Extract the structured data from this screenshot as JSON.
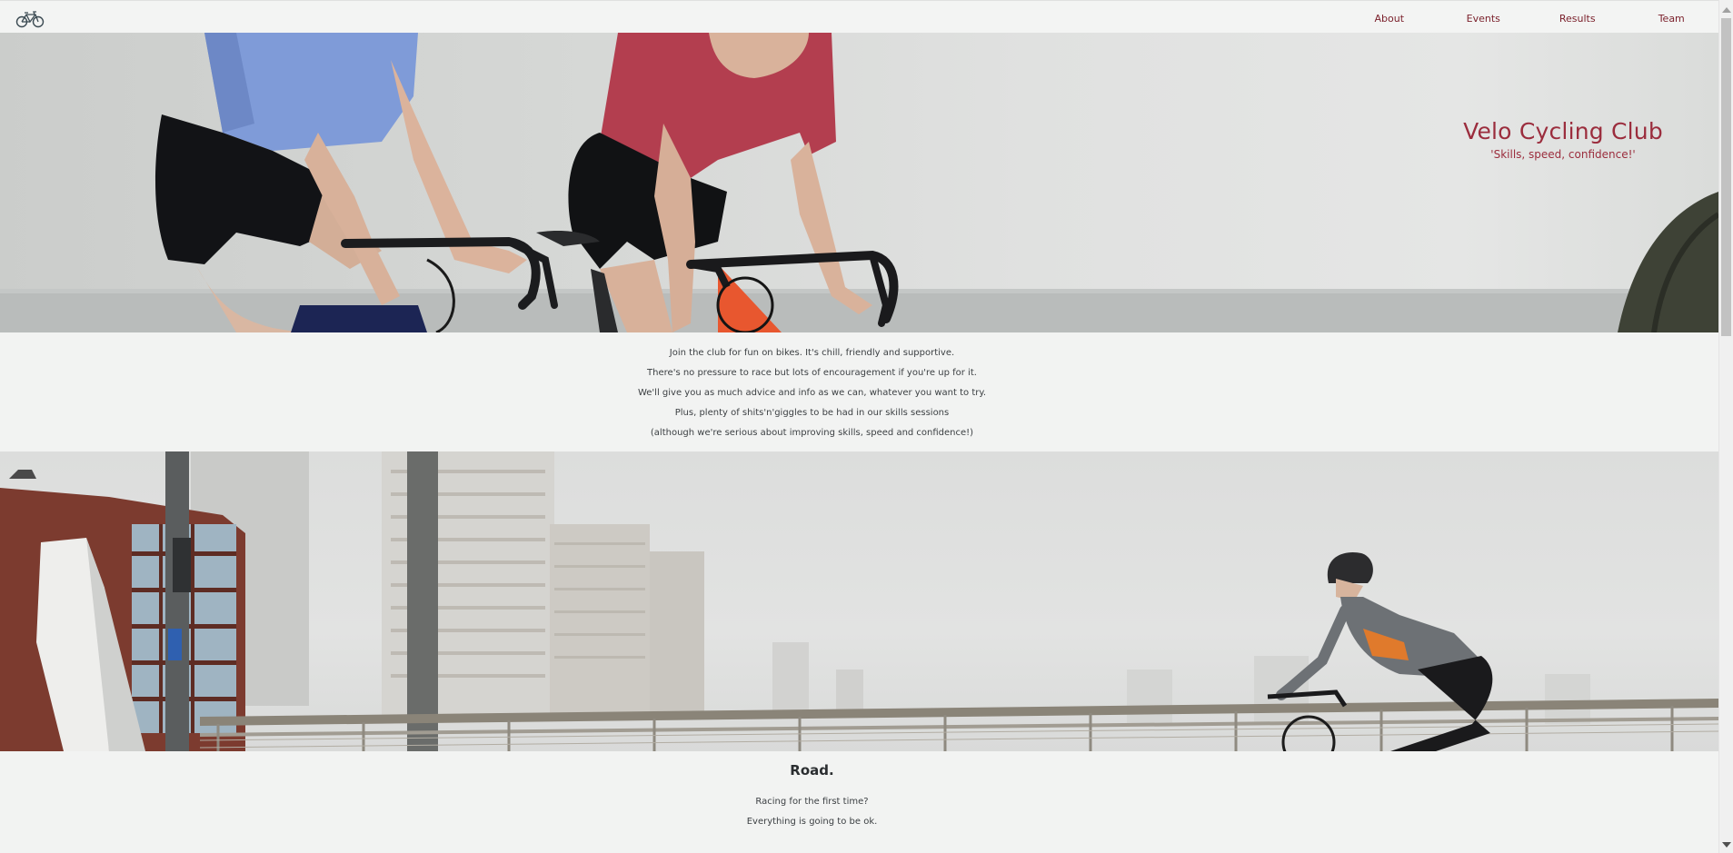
{
  "nav": {
    "logo_icon": "bicycle-icon",
    "links": [
      {
        "label": "About"
      },
      {
        "label": "Events"
      },
      {
        "label": "Results"
      },
      {
        "label": "Team"
      }
    ]
  },
  "hero": {
    "title": "Velo Cycling Club",
    "tagline": "'Skills, speed, confidence!'"
  },
  "intro": {
    "lines": [
      "Join the club for fun on bikes. It's chill, friendly and supportive.",
      "There's no pressure to race but lots of encouragement if you're up for it.",
      "We'll give you as much advice and info as we can, whatever you want to try.",
      "Plus, plenty of shits'n'giggles to be had in our skills sessions",
      "(although we're serious about improving skills, speed and confidence!)"
    ]
  },
  "road": {
    "heading": "Road.",
    "lines": [
      "Racing for the first time?",
      "Everything is going to be ok."
    ]
  },
  "colors": {
    "accent": "#9b2d3d",
    "nav_link": "#7a1f2a",
    "background": "#f2f3f2"
  }
}
